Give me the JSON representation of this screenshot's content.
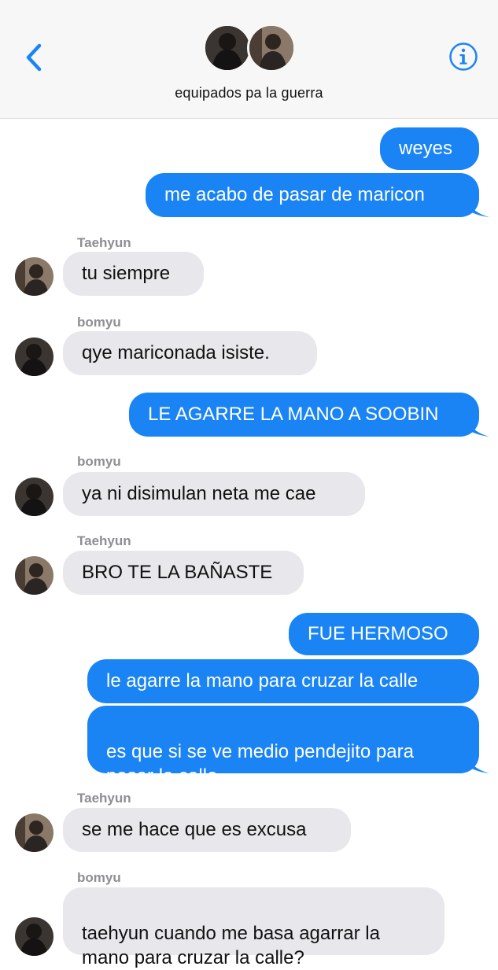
{
  "header": {
    "title": "equipados pa la guerra",
    "back_icon": "chevron-left-icon",
    "info_icon": "info-circle-icon",
    "accent": "#1a84f5"
  },
  "messages": [
    {
      "from": "me",
      "text": "weyes"
    },
    {
      "from": "me",
      "text": "me acabo de pasar de maricon"
    },
    {
      "from": "Taehyun",
      "text": "tu siempre"
    },
    {
      "from": "bomyu",
      "text": "qye mariconada isiste."
    },
    {
      "from": "me",
      "text": "LE AGARRE LA MANO A SOOBIN"
    },
    {
      "from": "bomyu",
      "text": "ya ni disimulan neta me cae"
    },
    {
      "from": "Taehyun",
      "text": "BRO TE LA BAÑASTE"
    },
    {
      "from": "me",
      "text": "FUE HERMOSO"
    },
    {
      "from": "me",
      "text": "le agarre la mano para cruzar la calle"
    },
    {
      "from": "me",
      "text": "es que si se ve medio pendejito para\npasar la calle"
    },
    {
      "from": "Taehyun",
      "text": "se me hace que es excusa"
    },
    {
      "from": "bomyu",
      "text": "taehyun cuando me basa agarrar la\nmano para cruzar la calle?"
    }
  ],
  "colors": {
    "outgoing_bubble": "#1a84f5",
    "incoming_bubble": "#e8e8ec",
    "sender_name": "#8e8e93"
  }
}
